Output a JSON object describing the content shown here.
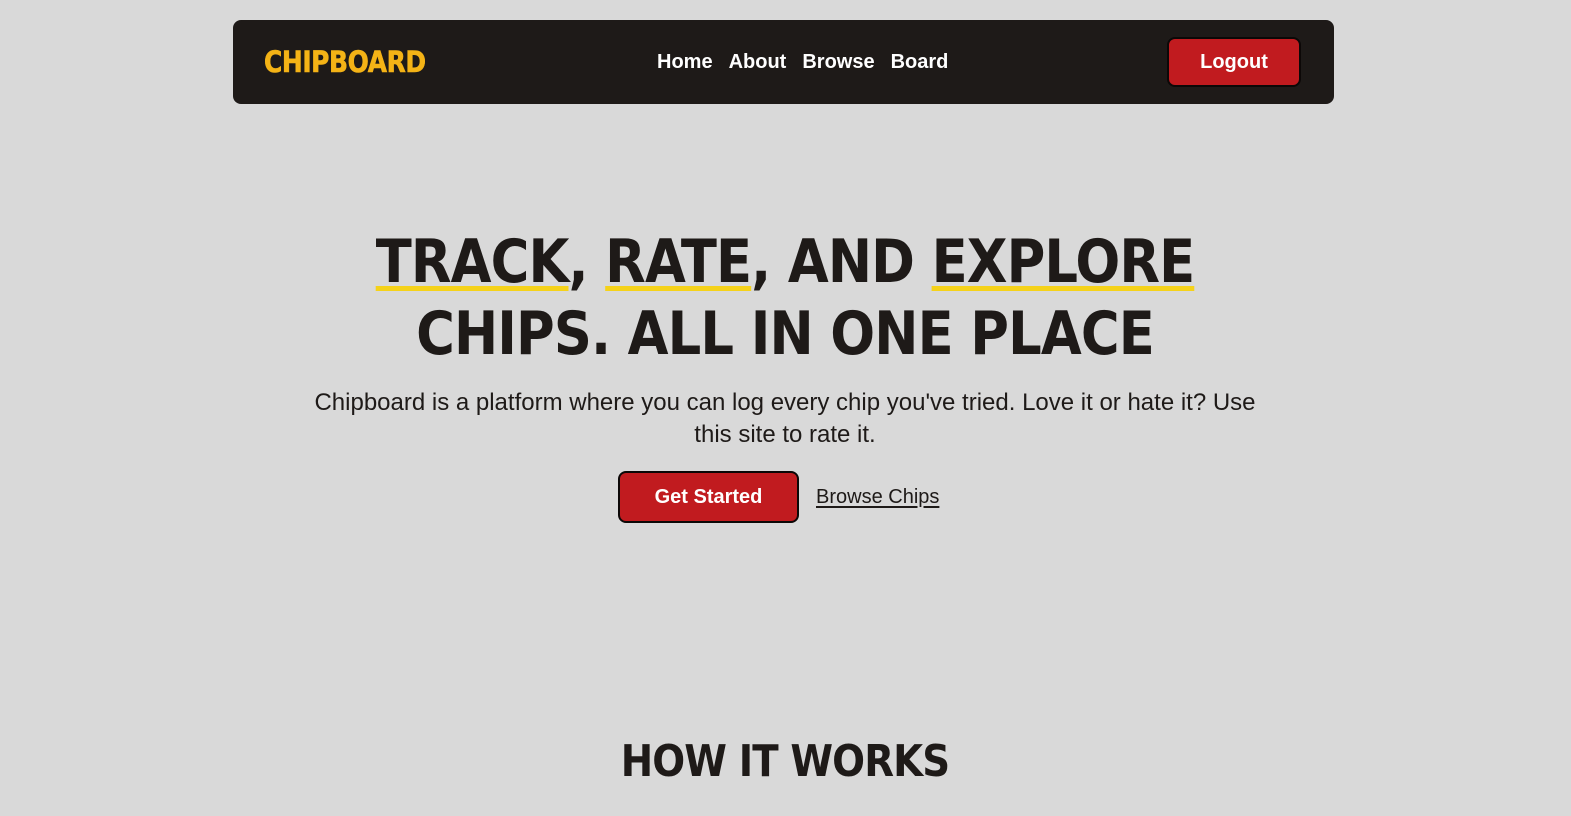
{
  "brand": {
    "logo_text": "CHIPBOARD",
    "accent_color": "#f4b316",
    "nav_bg": "#1e1a18",
    "button_color": "#c11b1f",
    "highlight_color": "#f5d21a",
    "page_bg": "#d9d9d9"
  },
  "nav": {
    "links": [
      {
        "label": "Home"
      },
      {
        "label": "About"
      },
      {
        "label": "Browse"
      },
      {
        "label": "Board"
      }
    ],
    "logout_label": "Logout"
  },
  "hero": {
    "title_words": {
      "track": "TRACK",
      "comma1": ", ",
      "rate": "RATE",
      "comma2": ", AND ",
      "explore": "EXPLORE",
      "line2": "CHIPS. ALL IN ONE PLACE"
    },
    "subtitle": "Chipboard is a platform where you can log every chip you've tried. Love it or hate it? Use this site to rate it.",
    "primary_cta": "Get Started",
    "secondary_cta": "Browse Chips"
  },
  "how_it_works": {
    "title": "HOW IT WORKS"
  }
}
